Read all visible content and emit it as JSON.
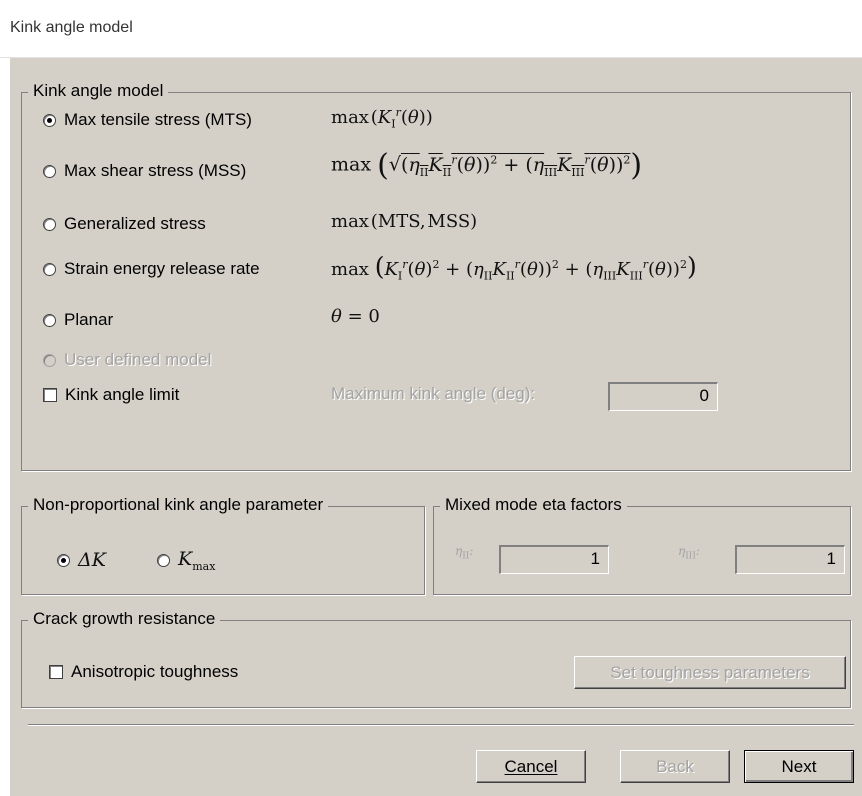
{
  "window": {
    "title": "Kink angle model"
  },
  "kink_group": {
    "label": "Kink angle model",
    "options": [
      {
        "label": "Max tensile stress (MTS)",
        "selected": true,
        "enabled": true
      },
      {
        "label": "Max shear stress (MSS)",
        "selected": false,
        "enabled": true
      },
      {
        "label": "Generalized stress",
        "selected": false,
        "enabled": true
      },
      {
        "label": "Strain energy release rate",
        "selected": false,
        "enabled": true
      },
      {
        "label": "Planar",
        "selected": false,
        "enabled": true
      },
      {
        "label": "User defined model",
        "selected": false,
        "enabled": false
      }
    ],
    "limit_checkbox": {
      "label": "Kink angle limit",
      "checked": false
    },
    "max_angle_label": "Maximum kink angle (deg):",
    "max_angle_value": "0",
    "formulas": {
      "mts": "max(K_I^r(θ))",
      "mss": "max(√((η_II K_II^r(θ))² + (η_III K_III^r(θ))²))",
      "generalized": "max(MTS, MSS)",
      "serr": "max(K_I^r(θ)² + (η_II K_II^r(θ))² + (η_III K_III^r(θ))²)",
      "planar": "θ = 0"
    }
  },
  "nonprop_group": {
    "label": "Non-proportional kink angle parameter",
    "options": [
      {
        "label": "ΔK",
        "selected": true
      },
      {
        "label": "K_max",
        "selected": false
      }
    ]
  },
  "eta_group": {
    "label": "Mixed mode eta factors",
    "eta2_value": "1",
    "eta3_value": "1"
  },
  "crack_group": {
    "label": "Crack growth resistance",
    "aniso_checkbox": {
      "label": "Anisotropic toughness",
      "checked": false
    },
    "set_button": "Set toughness parameters"
  },
  "buttons": {
    "cancel": "Cancel",
    "back": "Back",
    "next": "Next"
  }
}
